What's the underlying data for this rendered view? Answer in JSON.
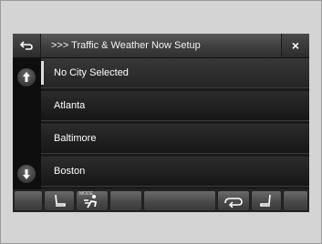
{
  "header": {
    "back_icon": "back-arrow-icon",
    "title": ">>> Traffic & Weather Now Setup",
    "close_label": "×"
  },
  "list": {
    "items": [
      {
        "label": "No City Selected"
      },
      {
        "label": "Atlanta"
      },
      {
        "label": "Baltimore"
      },
      {
        "label": "Boston"
      }
    ]
  },
  "scroll": {
    "up_icon": "scroll-up-icon",
    "down_icon": "scroll-down-icon"
  },
  "bottom_bar": {
    "climate_mode_label": "MODE",
    "icons": [
      "blank",
      "seat-left-icon",
      "climate-mode-icon",
      "blank",
      "blank",
      "recirculation-icon",
      "seat-right-icon",
      "blank"
    ]
  },
  "colors": {
    "screen_bg": "#1a1a1a",
    "text": "#ffffff",
    "frame_bg": "#d4d4d4"
  }
}
